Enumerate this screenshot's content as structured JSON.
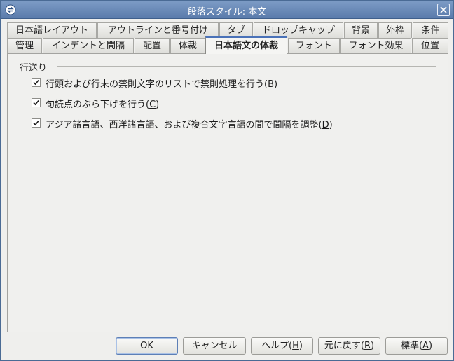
{
  "window": {
    "title": "段落スタイル: 本文"
  },
  "tabs_row1": [
    "日本語レイアウト",
    "アウトラインと番号付け",
    "タブ",
    "ドロップキャップ",
    "背景",
    "外枠",
    "条件"
  ],
  "tabs_row2": [
    "管理",
    "インデントと間隔",
    "配置",
    "体裁",
    "日本語文の体裁",
    "フォント",
    "フォント効果",
    "位置"
  ],
  "active_tab": "日本語文の体裁",
  "group": {
    "label": "行送り"
  },
  "options": [
    {
      "text": "行頭および行末の禁則文字のリストで禁則処理を行う(",
      "key": "B",
      "close": ")",
      "checked": true
    },
    {
      "text": "句読点のぶら下げを行う(",
      "key": "C",
      "close": ")",
      "checked": true
    },
    {
      "text": "アジア諸言語、西洋諸言語、および複合文字言語の間で間隔を調整(",
      "key": "D",
      "close": ")",
      "checked": true
    }
  ],
  "buttons": {
    "ok": {
      "label": "OK"
    },
    "cancel": {
      "label": "キャンセル"
    },
    "help": {
      "pre": "ヘルプ(",
      "key": "H",
      "post": ")"
    },
    "reset": {
      "pre": "元に戻す(",
      "key": "R",
      "post": ")"
    },
    "standard": {
      "pre": "標準(",
      "key": "A",
      "post": ")"
    }
  },
  "colors": {
    "titlebar": "#6a8bbb",
    "accent": "#4a72b8"
  },
  "icons": {
    "title": "refresh-icon",
    "close": "close-icon",
    "check": "checkmark-icon"
  }
}
